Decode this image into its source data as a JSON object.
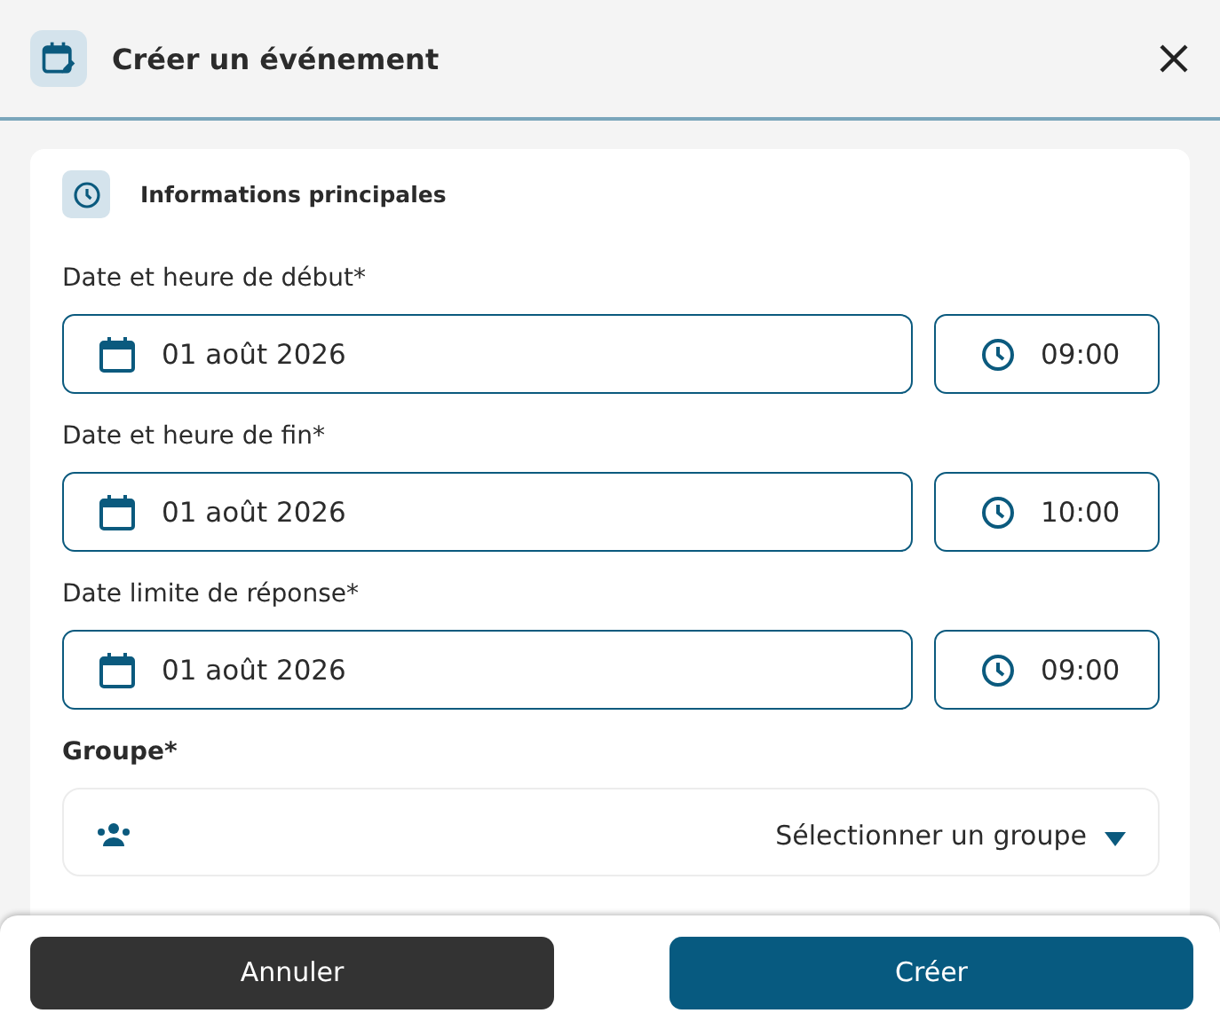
{
  "dialog": {
    "title": "Créer un événement"
  },
  "section": {
    "title": "Informations principales"
  },
  "fields": [
    {
      "label": "Date et heure de début*",
      "date": "01 août 2026",
      "time": "09:00"
    },
    {
      "label": "Date et heure de fin*",
      "date": "01 août 2026",
      "time": "10:00"
    },
    {
      "label": "Date limite de réponse*",
      "date": "01 août 2026",
      "time": "09:00"
    }
  ],
  "group": {
    "label": "Groupe*",
    "placeholder": "Sélectionner un groupe"
  },
  "buttons": [
    {
      "label": "Annuler",
      "kind": "secondary"
    },
    {
      "label": "Créer",
      "kind": "primary"
    }
  ]
}
